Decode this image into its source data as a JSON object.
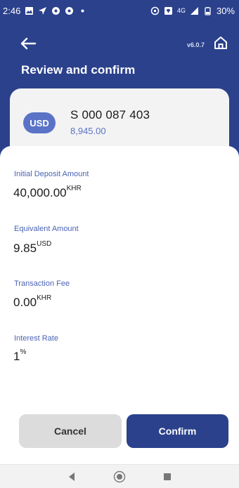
{
  "status_bar": {
    "time": "2:46",
    "network": "4G",
    "battery": "30%",
    "icons": [
      "gallery-icon",
      "navigation-icon",
      "location-icon",
      "location-icon",
      "dot-icon",
      "vpn-icon",
      "wifi-icon",
      "signal-icon",
      "battery-icon"
    ]
  },
  "header": {
    "version": "v6.0.7",
    "title": "Review and confirm"
  },
  "account": {
    "currency": "USD",
    "number": "S 000 087 403",
    "balance": "8,945.00"
  },
  "details": [
    {
      "label": "Initial Deposit Amount",
      "value": "40,000.00",
      "unit": "KHR"
    },
    {
      "label": "Equivalent Amount",
      "value": "9.85",
      "unit": "USD"
    },
    {
      "label": "Transaction Fee",
      "value": "0.00",
      "unit": "KHR"
    },
    {
      "label": "Interest Rate",
      "value": "1",
      "unit": "%"
    }
  ],
  "buttons": {
    "cancel": "Cancel",
    "confirm": "Confirm"
  },
  "colors": {
    "primary": "#2b418c",
    "accent": "#5a73c7",
    "label": "#4a63b5"
  }
}
